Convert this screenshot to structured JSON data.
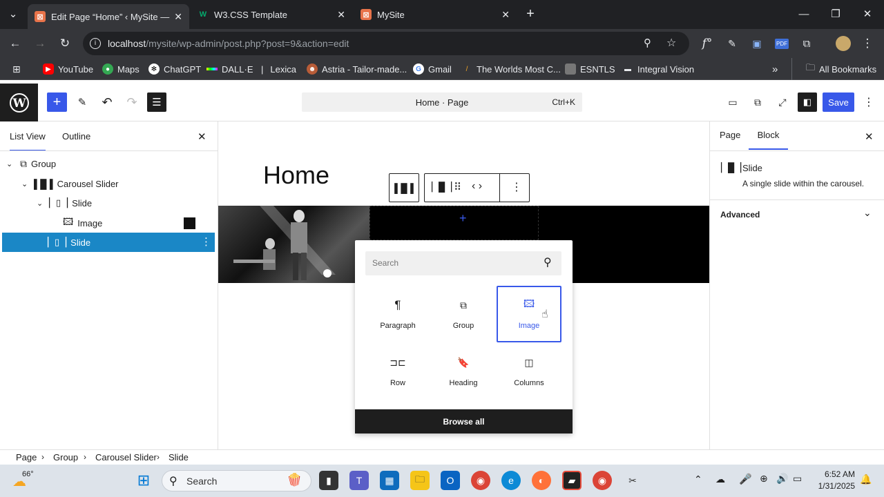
{
  "browser": {
    "tabs": [
      {
        "title": "Edit Page “Home” ‹ MySite — W",
        "active": true
      },
      {
        "title": "W3.CSS Template",
        "active": false
      },
      {
        "title": "MySite",
        "active": false
      }
    ],
    "url_host": "localhost",
    "url_path": "/mysite/wp-admin/post.php?post=9&action=edit",
    "bookmarks": [
      "YouTube",
      "Maps",
      "ChatGPT",
      "DALL·E",
      "Lexica",
      "Astria - Tailor-made...",
      "Gmail",
      "The Worlds Most C...",
      "ESNTLS",
      "Integral Vision"
    ],
    "all_bookmarks": "All Bookmarks"
  },
  "editor": {
    "command_title": "Home · Page",
    "command_shortcut": "Ctrl+K",
    "save_label": "Save",
    "left_tabs": [
      "List View",
      "Outline"
    ],
    "tree": [
      {
        "label": "Group",
        "indent": 0
      },
      {
        "label": "Carousel Slider",
        "indent": 1
      },
      {
        "label": "Slide",
        "indent": 2
      },
      {
        "label": "Image",
        "indent": 3
      },
      {
        "label": "Slide",
        "indent": 2,
        "selected": true
      }
    ],
    "page_title": "Home",
    "inserter": {
      "search_placeholder": "Search",
      "blocks": [
        "Paragraph",
        "Group",
        "Image",
        "Row",
        "Heading",
        "Columns"
      ],
      "highlighted": "Image",
      "browse_all": "Browse all"
    },
    "right_tabs": [
      "Page",
      "Block"
    ],
    "block_name": "Slide",
    "block_desc": "A single slide within the carousel.",
    "advanced": "Advanced",
    "breadcrumb": [
      "Page",
      "Group",
      "Carousel Slider",
      "Slide"
    ]
  },
  "taskbar": {
    "weather": "66°",
    "search": "Search",
    "time": "6:52 AM",
    "date": "1/31/2025"
  },
  "colors": {
    "accent": "#3858e9",
    "selection": "#1a87c6"
  }
}
